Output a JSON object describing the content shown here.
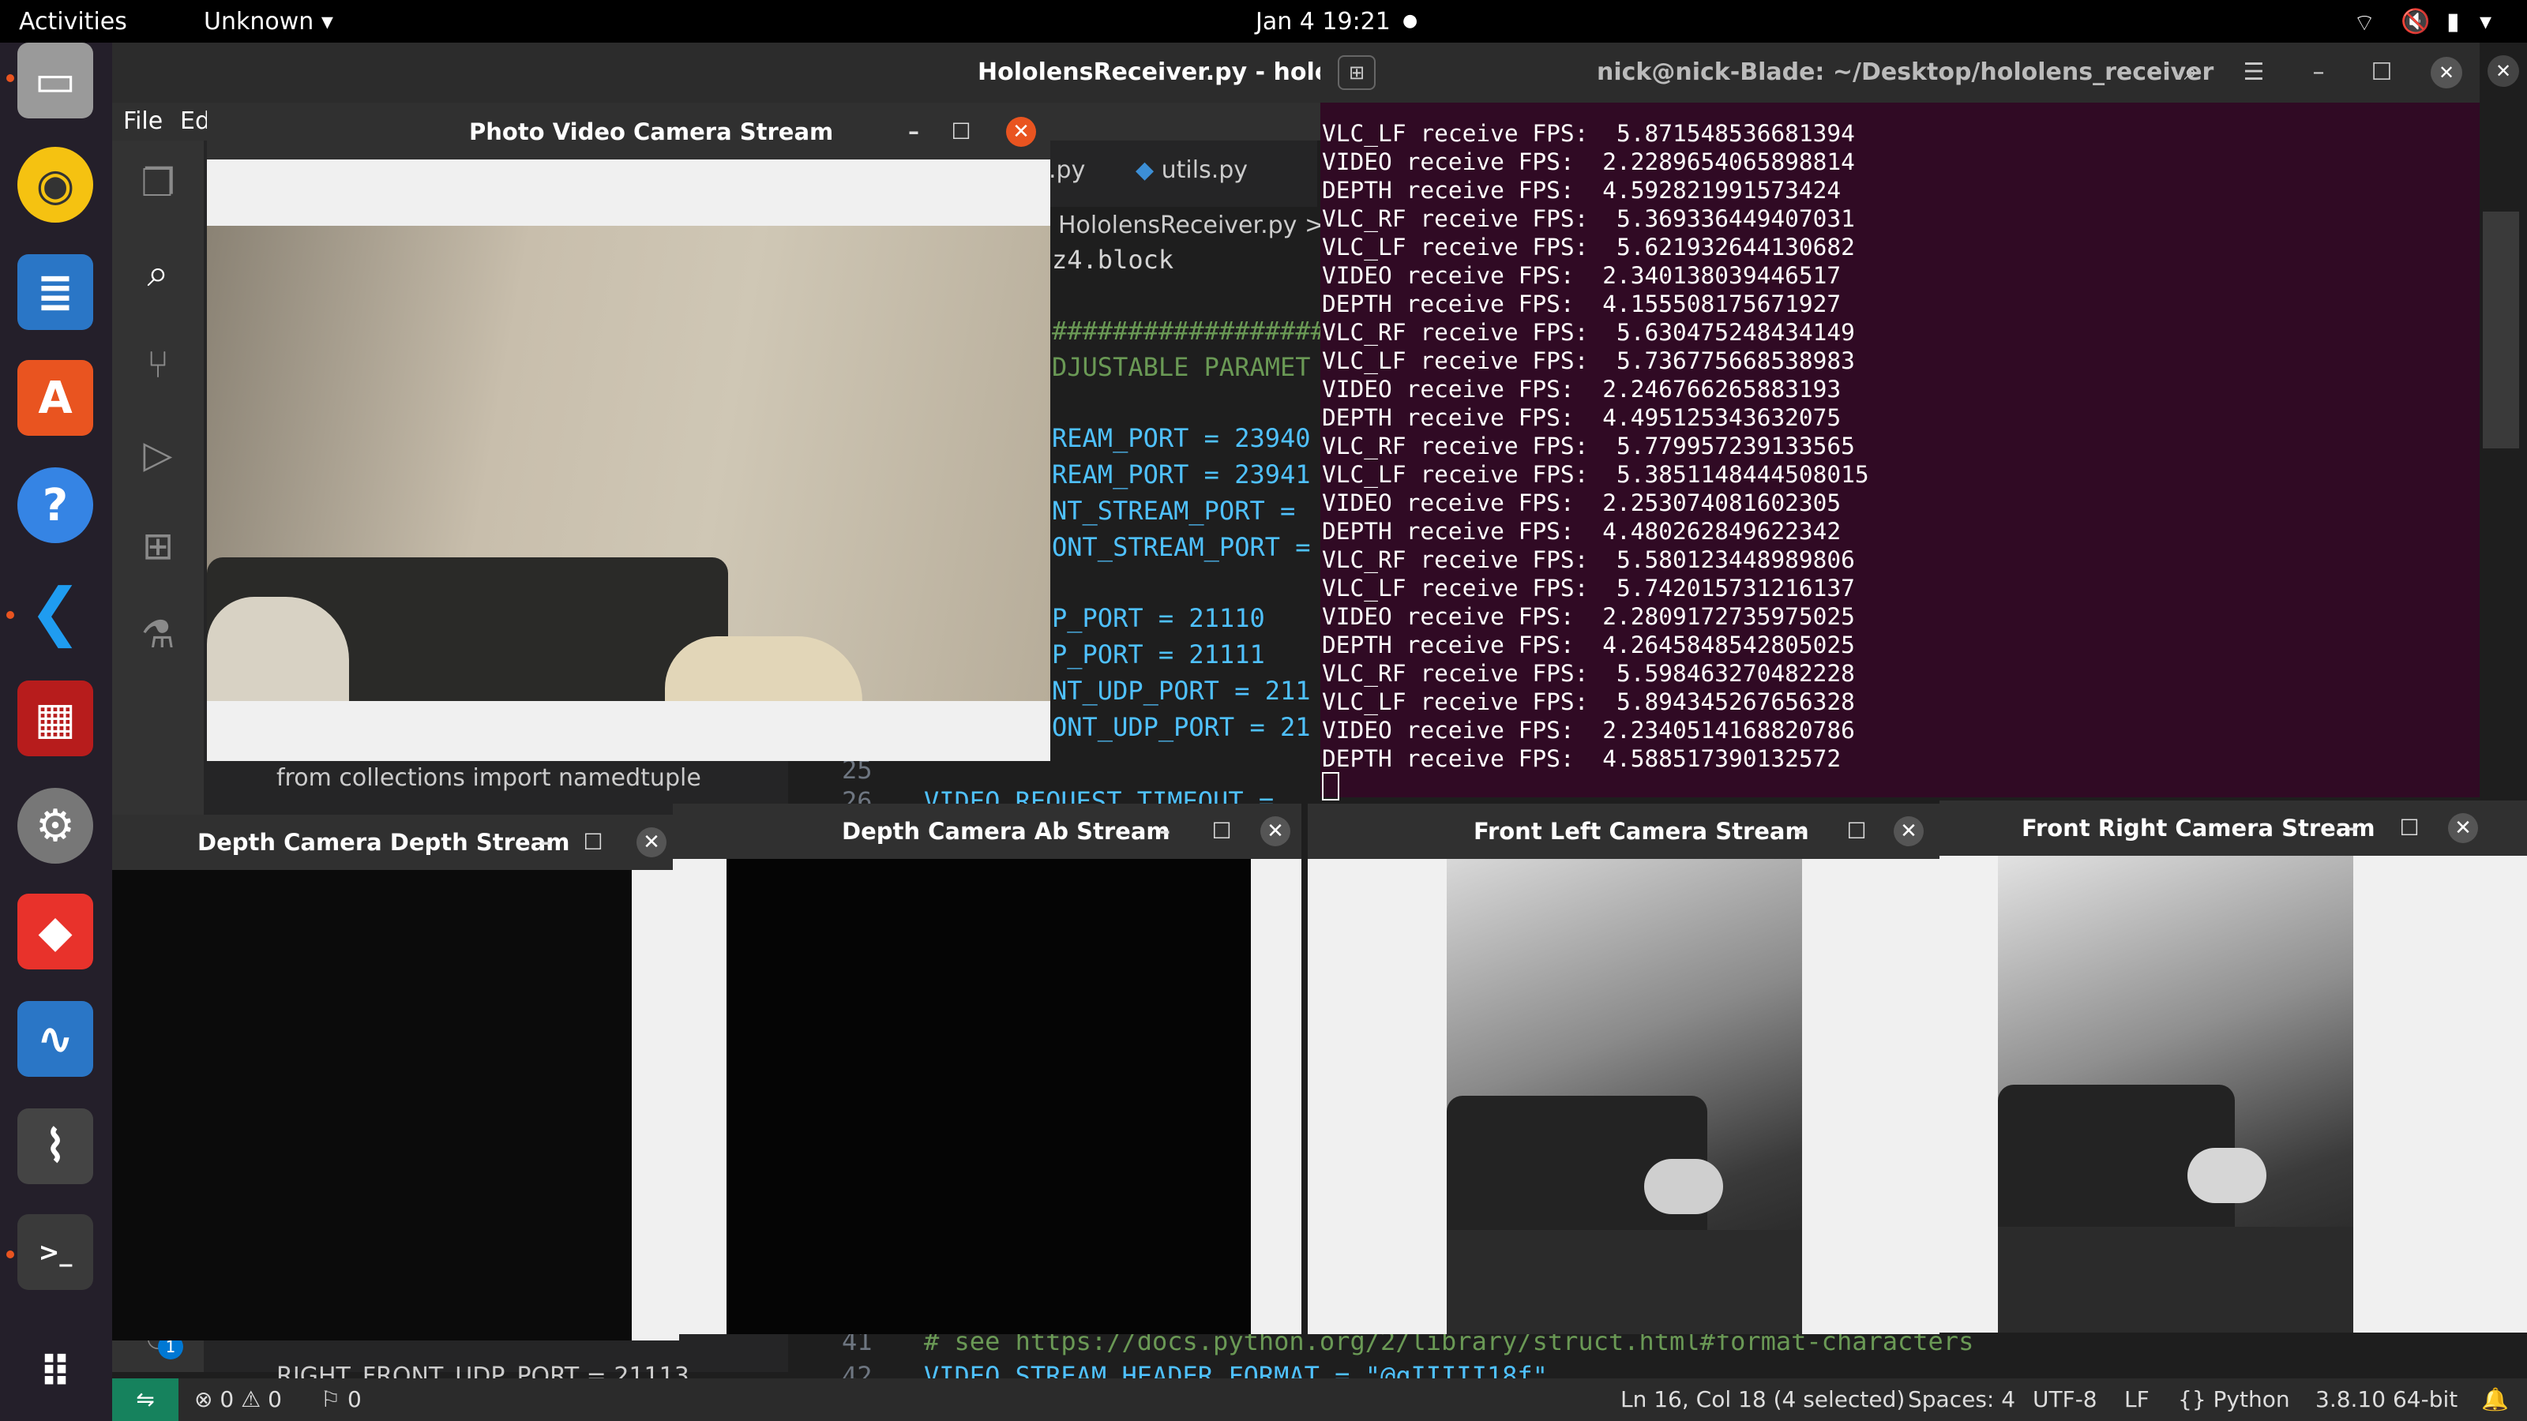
{
  "topbar": {
    "activities": "Activities",
    "app_menu": "Unknown",
    "clock": "Jan 4  19:21"
  },
  "vscode": {
    "title": "HololensReceiver.py - hololens",
    "menu": [
      "File",
      "Ed"
    ],
    "tabs": [
      ".py",
      "utils.py"
    ],
    "breadcrumb": "HololensReceiver.py >",
    "code_lines": [
      {
        "num": "",
        "text": "z4.block"
      },
      {
        "num": "",
        "text": "##################"
      },
      {
        "num": "",
        "text": "DJUSTABLE PARAMET"
      },
      {
        "num": "",
        "text": "REAM_PORT = 23940"
      },
      {
        "num": "",
        "text": "REAM_PORT = 23941"
      },
      {
        "num": "",
        "text": "NT_STREAM_PORT ="
      },
      {
        "num": "",
        "text": "ONT_STREAM_PORT ="
      },
      {
        "num": "",
        "text": "P_PORT = 21110"
      },
      {
        "num": "",
        "text": "P_PORT = 21111"
      },
      {
        "num": "",
        "text": "NT_UDP_PORT = 211"
      },
      {
        "num": "",
        "text": "ONT_UDP_PORT = 21"
      },
      {
        "num": "25",
        "text": ""
      },
      {
        "num": "26",
        "text": "VIDEO_REQUEST_TIMEOUT ="
      },
      {
        "num": "41",
        "text": "# see https://docs.python.org/2/library/struct.html#format-characters"
      },
      {
        "num": "42",
        "text": "VIDEO_STREAM_HEADER_FORMAT = \"@qIIIII18f\""
      }
    ],
    "sidebar_import": "from collections import namedtuple",
    "sidebar_port_line": "RIGHT_FRONT_UDP_PORT = 21113",
    "status": {
      "errors": "0",
      "warnings": "0",
      "ports": "0",
      "position": "Ln 16, Col 18 (4 selected)",
      "spaces": "Spaces: 4",
      "encoding": "UTF-8",
      "eol": "LF",
      "language": "Python",
      "interpreter": "3.8.10 64-bit",
      "badge": "1"
    }
  },
  "terminal": {
    "title": "nick@nick-Blade: ~/Desktop/hololens_receiver",
    "lines": [
      "VLC_LF receive FPS:  5.871548536681394",
      "VIDEO receive FPS:  2.2289654065898814",
      "DEPTH receive FPS:  4.592821991573424",
      "VLC_RF receive FPS:  5.369336449407031",
      "VLC_LF receive FPS:  5.621932644130682",
      "VIDEO receive FPS:  2.340138039446517",
      "DEPTH receive FPS:  4.155508175671927",
      "VLC_RF receive FPS:  5.630475248434149",
      "VLC_LF receive FPS:  5.736775668538983",
      "VIDEO receive FPS:  2.246766265883193",
      "DEPTH receive FPS:  4.495125343632075",
      "VLC_RF receive FPS:  5.779957239133565",
      "VLC_LF receive FPS:  5.3851148444508015",
      "VIDEO receive FPS:  2.253074081602305",
      "DEPTH receive FPS:  4.480262849622342",
      "VLC_RF receive FPS:  5.580123448989806",
      "VLC_LF receive FPS:  5.742015731216137",
      "VIDEO receive FPS:  2.2809172735975025",
      "DEPTH receive FPS:  4.2645848542805025",
      "VLC_RF receive FPS:  5.598463270482228",
      "VLC_LF receive FPS:  5.894345267656328",
      "VIDEO receive FPS:  2.2340514168820786",
      "DEPTH receive FPS:  4.588517390132572"
    ]
  },
  "windows": {
    "pv": "Photo Video Camera Stream",
    "depth": "Depth Camera Depth Stream",
    "ab": "Depth Camera Ab Stream",
    "left": "Front Left Camera Stream",
    "right": "Front Right Camera Stream"
  }
}
